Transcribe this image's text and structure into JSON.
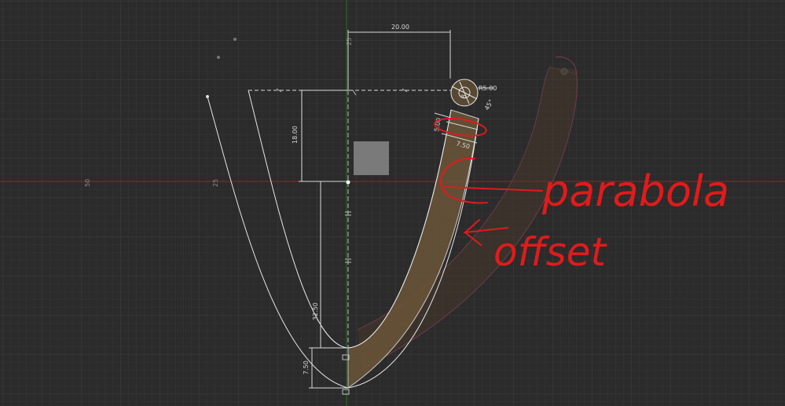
{
  "colors": {
    "background": "#2b2b2b",
    "grid_minor": "#353535",
    "grid_major": "#3f3f3f",
    "x_axis": "#8e2a2a",
    "y_axis": "#2e6b2e",
    "sketch_line": "#e6e6e6",
    "offset_fill": "#6b5538",
    "annotation_red": "#e01b1b",
    "ghost_profile": "#7a3d55"
  },
  "axis_labels": {
    "x_50": "50",
    "x_25": "25",
    "y_25": "25"
  },
  "dimensions": {
    "top_width": "20.00",
    "left_height": "18.00",
    "center_height": "32.50",
    "bottom_height": "7.50",
    "radius": "R5.00",
    "offset_width": "7.50",
    "offset_small": "5.00",
    "small_angle": "45°",
    "small_tick": "8"
  },
  "annotations": {
    "parabola": "parabola",
    "offset": "offset"
  }
}
